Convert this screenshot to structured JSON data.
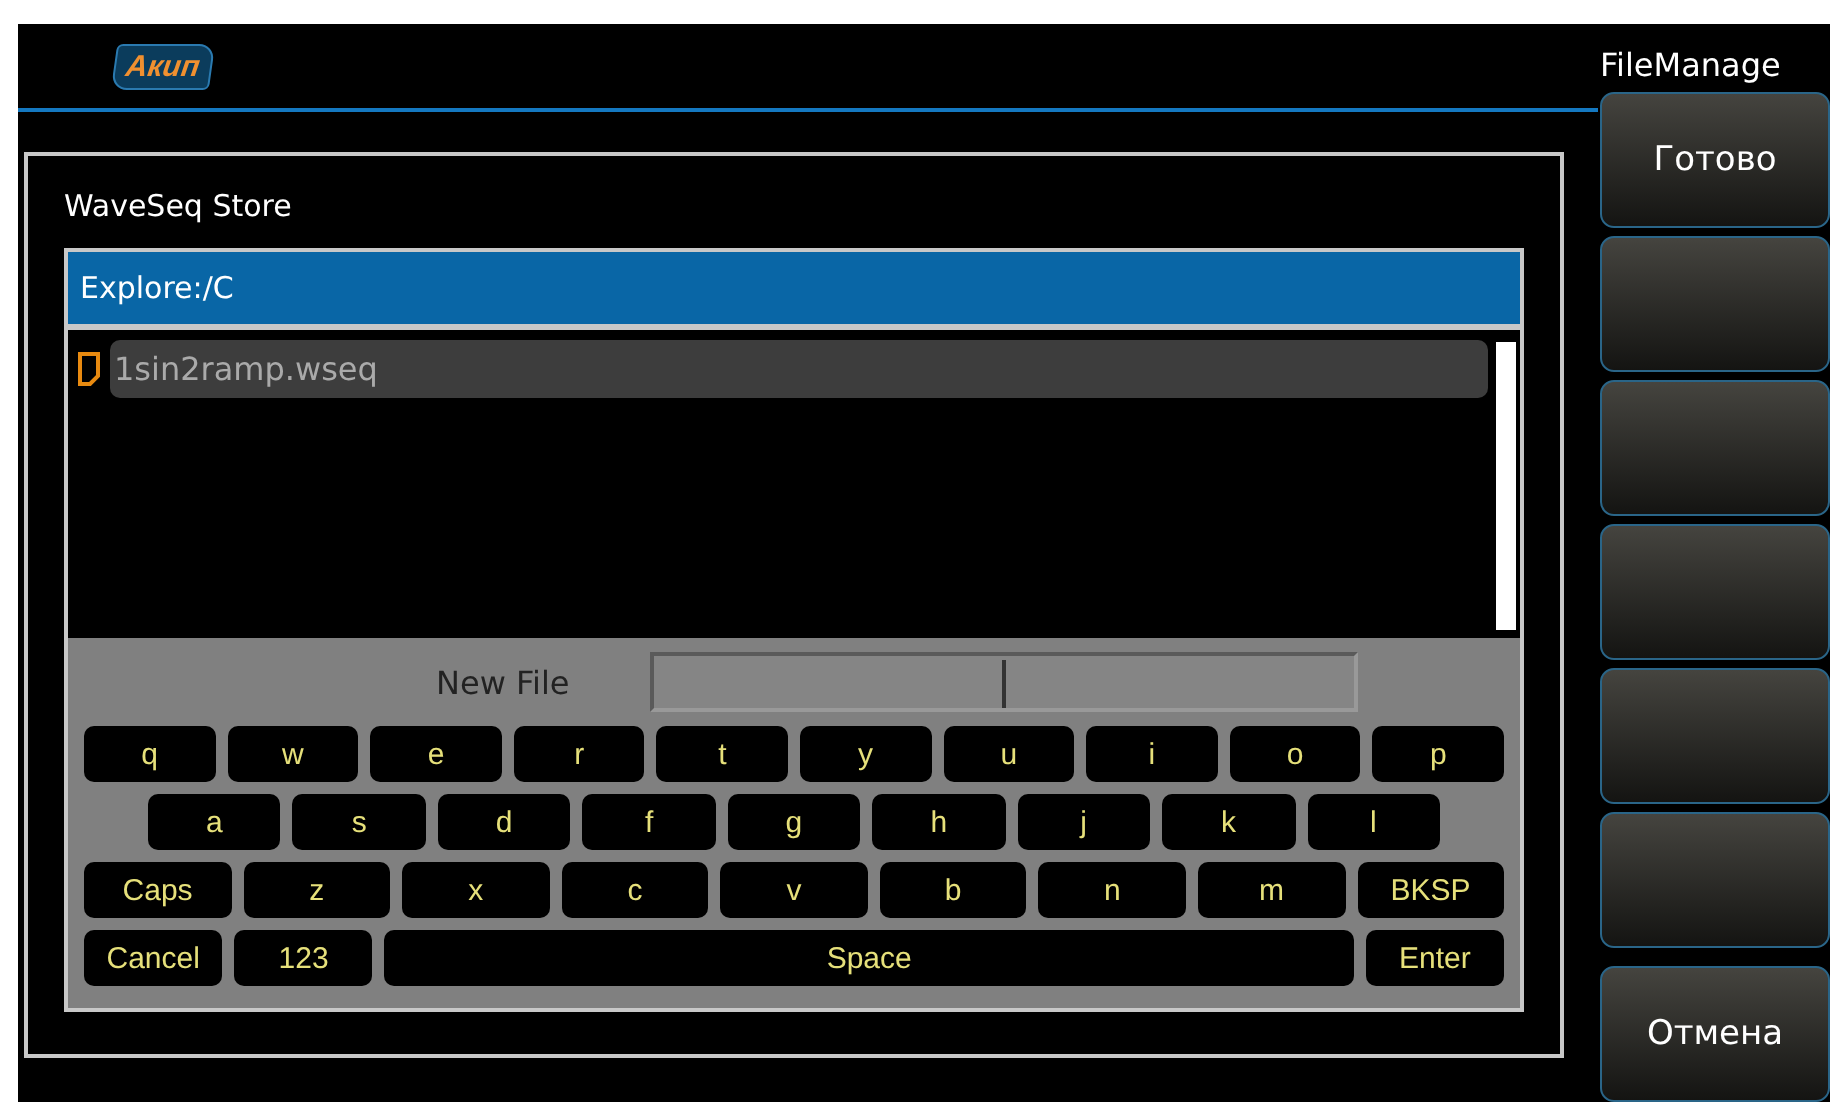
{
  "header": {
    "logo": "Акип"
  },
  "side_panel": {
    "title": "FileManage",
    "softkeys": [
      {
        "kind": "labeled",
        "label": "Готово"
      },
      {
        "kind": "blank"
      },
      {
        "kind": "blank"
      },
      {
        "kind": "blank"
      },
      {
        "kind": "blank"
      },
      {
        "kind": "blank"
      },
      {
        "kind": "labeled",
        "label": "Отмена"
      }
    ]
  },
  "dialog": {
    "title": "WaveSeq Store",
    "path": "Explore:/C",
    "files": [
      {
        "name": "1sin2ramp.wseq",
        "selected": true
      }
    ],
    "keyboard": {
      "label": "New File",
      "rows": [
        {
          "keys": [
            {
              "label": "q",
              "kind": "key"
            },
            {
              "label": "w",
              "kind": "key"
            },
            {
              "label": "e",
              "kind": "key"
            },
            {
              "label": "r",
              "kind": "key"
            },
            {
              "label": "t",
              "kind": "key"
            },
            {
              "label": "y",
              "kind": "key"
            },
            {
              "label": "u",
              "kind": "key"
            },
            {
              "label": "i",
              "kind": "key"
            },
            {
              "label": "o",
              "kind": "key"
            },
            {
              "label": "p",
              "kind": "key"
            }
          ]
        },
        {
          "keys": [
            {
              "label": "a",
              "kind": "key"
            },
            {
              "label": "s",
              "kind": "key"
            },
            {
              "label": "d",
              "kind": "key"
            },
            {
              "label": "f",
              "kind": "key"
            },
            {
              "label": "g",
              "kind": "key"
            },
            {
              "label": "h",
              "kind": "key"
            },
            {
              "label": "j",
              "kind": "key"
            },
            {
              "label": "k",
              "kind": "key"
            },
            {
              "label": "l",
              "kind": "key"
            }
          ]
        },
        {
          "keys": [
            {
              "label": "Caps",
              "kind": "key"
            },
            {
              "label": "z",
              "kind": "key"
            },
            {
              "label": "x",
              "kind": "key"
            },
            {
              "label": "c",
              "kind": "key"
            },
            {
              "label": "v",
              "kind": "key"
            },
            {
              "label": "b",
              "kind": "key"
            },
            {
              "label": "n",
              "kind": "key"
            },
            {
              "label": "m",
              "kind": "key"
            },
            {
              "label": "BKSP",
              "kind": "key"
            }
          ]
        },
        {
          "keys": [
            {
              "label": "Cancel",
              "kind": "key"
            },
            {
              "label": "123",
              "kind": "key"
            },
            {
              "label": "Space",
              "kind": "space"
            },
            {
              "label": "Enter",
              "kind": "key"
            }
          ]
        }
      ]
    }
  }
}
